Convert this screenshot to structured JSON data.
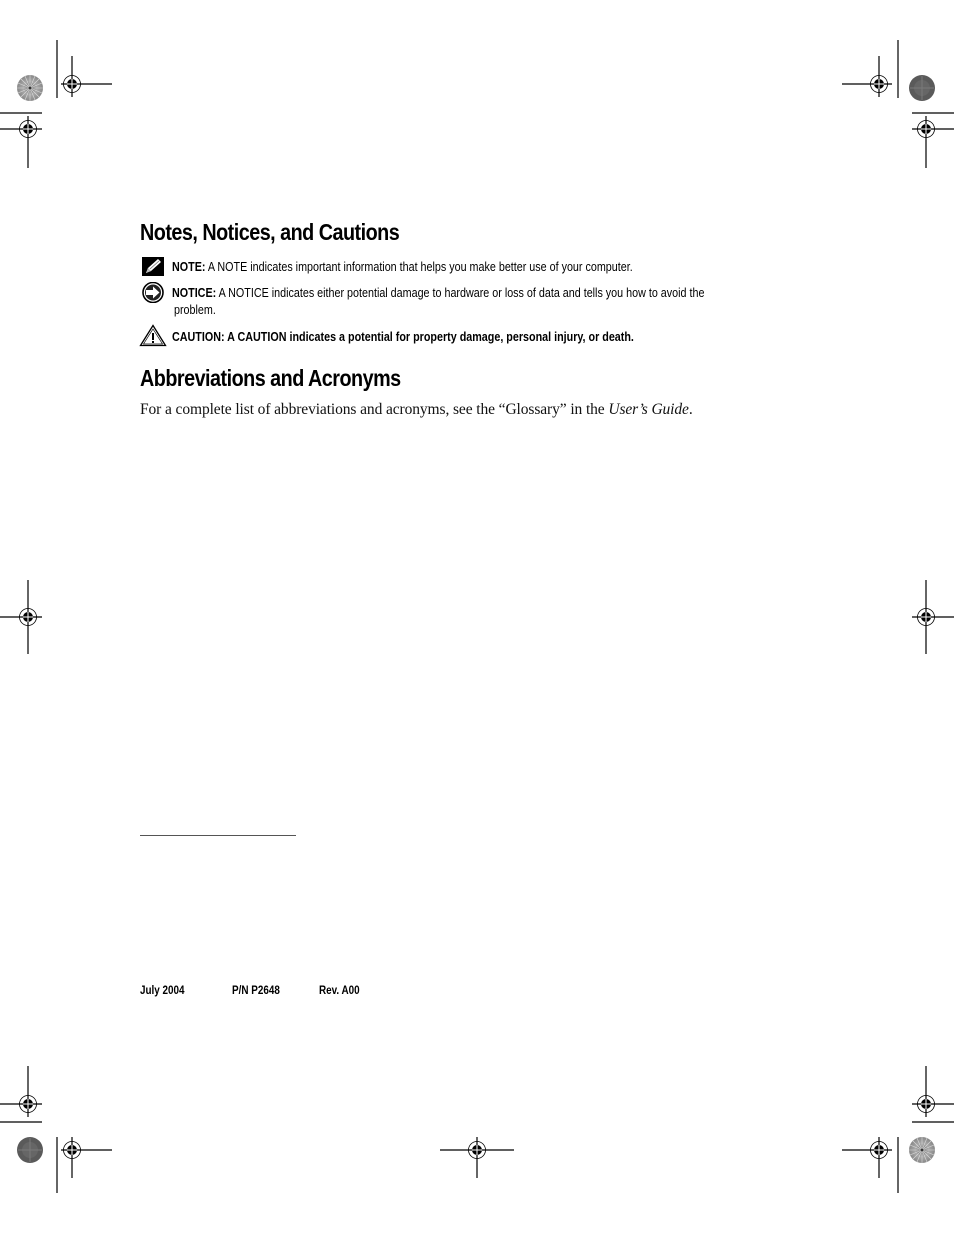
{
  "sections": {
    "notes": {
      "title": "Notes, Notices, and Cautions",
      "items": [
        {
          "icon": "pencil-icon",
          "label": "NOTE:",
          "text": "A NOTE indicates important information that helps you make better use of your computer."
        },
        {
          "icon": "notice-arrow-icon",
          "label": "NOTICE:",
          "text": "A NOTICE indicates either potential damage to hardware or loss of data and tells you how to avoid the",
          "text_continued": "problem."
        },
        {
          "icon": "warning-triangle-icon",
          "label": "CAUTION:",
          "text": "A CAUTION indicates a potential for property damage, personal injury, or death."
        }
      ]
    },
    "abbreviations": {
      "title": "Abbreviations and Acronyms",
      "body_prefix": "For a complete list of abbreviations and acronyms, see the “Glossary” in the ",
      "body_italic": "User’s Guide",
      "body_suffix": "."
    }
  },
  "footer": {
    "date": "July 2004",
    "part_number": "P/N P2648",
    "revision": "Rev. A00"
  }
}
